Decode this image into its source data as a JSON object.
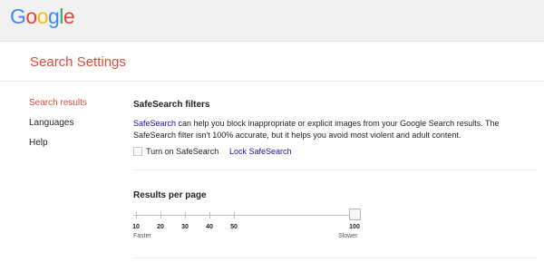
{
  "app": {
    "logo_text": "Google",
    "logo_colors": [
      "#4285f4",
      "#ea4335",
      "#fbbc05",
      "#4285f4",
      "#34a853",
      "#ea4335"
    ]
  },
  "page": {
    "title": "Search Settings",
    "accent_color": "#dd4b39",
    "link_color": "#1a0dab"
  },
  "sidebar": {
    "items": [
      {
        "label": "Search results",
        "active": true
      },
      {
        "label": "Languages",
        "active": false
      },
      {
        "label": "Help",
        "active": false
      }
    ]
  },
  "safesearch": {
    "heading": "SafeSearch filters",
    "link_text": "SafeSearch",
    "description": " can help you block inappropriate or explicit images from your Google Search results. The SafeSearch filter isn't 100% accurate, but it helps you avoid most violent and adult content.",
    "checkbox_label": "Turn on SafeSearch",
    "checkbox_checked": false,
    "lock_link": "Lock SafeSearch"
  },
  "results_per_page": {
    "heading": "Results per page",
    "ticks": [
      "10",
      "20",
      "30",
      "40",
      "50",
      "100"
    ],
    "selected_value": 100,
    "left_label": "Faster",
    "right_label": "Slower"
  }
}
